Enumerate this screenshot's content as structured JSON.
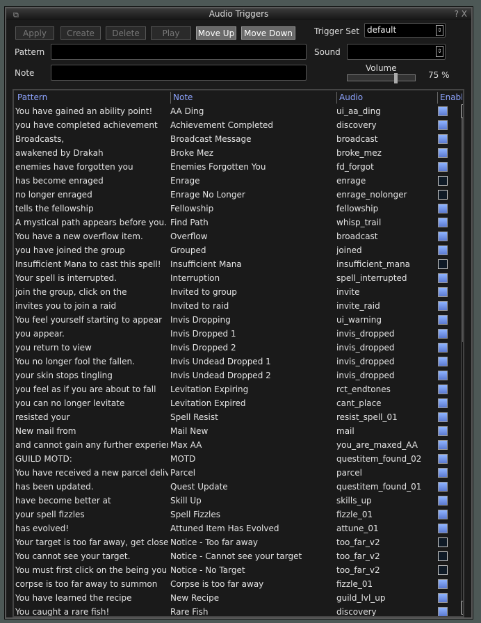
{
  "window": {
    "title": "Audio Triggers",
    "help": "?",
    "close": "X"
  },
  "toolbar": {
    "apply": "Apply",
    "create": "Create",
    "delete": "Delete",
    "play": "Play",
    "move_up": "Move Up",
    "move_down": "Move Down"
  },
  "trigger_set": {
    "label": "Trigger Set",
    "value": "default"
  },
  "sound": {
    "label": "Sound",
    "value": ""
  },
  "pattern": {
    "label": "Pattern",
    "value": ""
  },
  "note": {
    "label": "Note",
    "value": ""
  },
  "volume": {
    "label": "Volume",
    "value": 75,
    "display": "75 %"
  },
  "columns": [
    "Pattern",
    "Note",
    "Audio",
    "Enable"
  ],
  "rows": [
    [
      "You have gained an ability point!",
      "AA Ding",
      "ui_aa_ding",
      true
    ],
    [
      "you have completed achievement",
      "Achievement Completed",
      "discovery",
      true
    ],
    [
      "Broadcasts,",
      "Broadcast Message",
      "broadcast",
      true
    ],
    [
      "awakened by Drakah",
      "Broke Mez",
      "broke_mez",
      true
    ],
    [
      "enemies have forgotten you",
      "Enemies Forgotten You",
      "fd_forgot",
      true
    ],
    [
      "has become enraged",
      "Enrage",
      "enrage",
      false
    ],
    [
      "no longer enraged",
      "Enrage No Longer",
      "enrage_nolonger",
      false
    ],
    [
      "tells the fellowship",
      "Fellowship",
      "fellowship",
      true
    ],
    [
      "A mystical path appears before you.",
      "Find Path",
      "whisp_trail",
      true
    ],
    [
      "You have a new overflow item.",
      "Overflow",
      "broadcast",
      true
    ],
    [
      "you have joined the group",
      "Grouped",
      "joined",
      true
    ],
    [
      "Insufficient Mana to cast this spell!",
      "Insufficient Mana",
      "insufficient_mana",
      false
    ],
    [
      "Your spell is interrupted.",
      "Interruption",
      "spell_interrupted",
      true
    ],
    [
      "join the group, click on the",
      "Invited to group",
      "invite",
      true
    ],
    [
      "invites you to join a raid",
      "Invited to raid",
      "invite_raid",
      true
    ],
    [
      "You feel yourself starting to appear",
      "Invis Dropping",
      "ui_warning",
      true
    ],
    [
      "you appear.",
      "Invis Dropped 1",
      "invis_dropped",
      true
    ],
    [
      "you return to view",
      "Invis Dropped 2",
      "invis_dropped",
      true
    ],
    [
      "You no longer fool the fallen.",
      "Invis Undead Dropped 1",
      "invis_dropped",
      true
    ],
    [
      "your skin stops tingling",
      "Invis Undead Dropped 2",
      "invis_dropped",
      true
    ],
    [
      "you feel as if you are about to fall",
      "Levitation Expiring",
      "rct_endtones",
      true
    ],
    [
      "you can no longer levitate",
      "Levitation Expired",
      "cant_place",
      true
    ],
    [
      "resisted your",
      "Spell Resist",
      "resist_spell_01",
      true
    ],
    [
      "New mail from",
      "Mail New",
      "mail",
      true
    ],
    [
      "and cannot gain any further experience u",
      "Max AA",
      "you_are_maxed_AA",
      true
    ],
    [
      "GUILD MOTD:",
      "MOTD",
      "questitem_found_02",
      true
    ],
    [
      "You have received a new parcel delivery!",
      "Parcel",
      "parcel",
      true
    ],
    [
      "has been updated.",
      "Quest Update",
      "questitem_found_01",
      true
    ],
    [
      "have become better at",
      "Skill Up",
      "skills_up",
      true
    ],
    [
      "your spell fizzles",
      "Spell Fizzles",
      "fizzle_01",
      true
    ],
    [
      "has evolved!",
      "Attuned Item Has Evolved",
      "attune_01",
      true
    ],
    [
      "Your target is too far away, get closer!",
      "Notice - Too far away",
      "too_far_v2",
      false
    ],
    [
      "You cannot see your target.",
      "Notice - Cannot see your target",
      "too_far_v2",
      false
    ],
    [
      "You must first click on the being you wish",
      "Notice - No Target",
      "too_far_v2",
      false
    ],
    [
      "corpse is too far away to summon",
      "Corpse is too far away",
      "fizzle_01",
      true
    ],
    [
      "You have learned the recipe",
      "New Recipe",
      "guild_lvl_up",
      true
    ],
    [
      "You caught a rare fish!",
      "Rare Fish",
      "discovery",
      true
    ]
  ]
}
